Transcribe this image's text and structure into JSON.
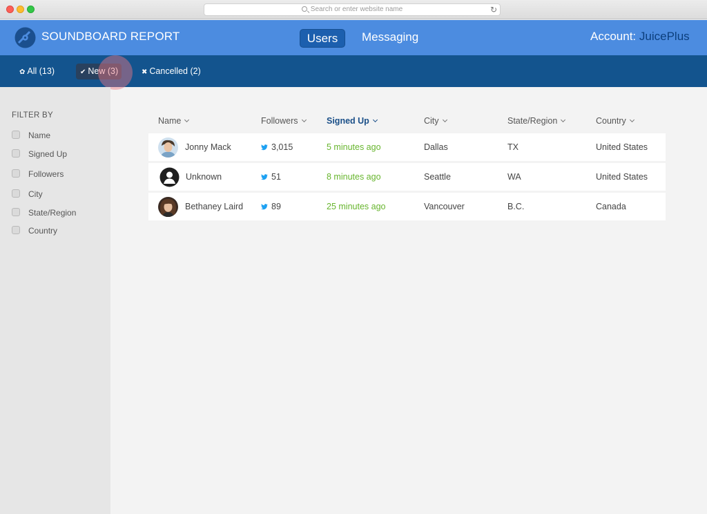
{
  "browser": {
    "url_placeholder": "Search or enter website name"
  },
  "header": {
    "brand": "SOUNDBOARD REPORT",
    "nav": [
      {
        "label": "Users",
        "active": true
      },
      {
        "label": "Messaging",
        "active": false
      }
    ],
    "account_label": "Account:",
    "account_name": "JuicePlus"
  },
  "tabs": [
    {
      "icon": "paw-icon",
      "label": "All (13)"
    },
    {
      "icon": "check-icon",
      "label": "New (3)",
      "active": true
    },
    {
      "icon": "x-icon",
      "label": "Cancelled (2)"
    }
  ],
  "sidebar": {
    "title": "FILTER BY",
    "filters": [
      "Name",
      "Signed Up",
      "Followers",
      "City",
      "State/Region",
      "Country"
    ]
  },
  "table": {
    "columns": [
      "Name",
      "Followers",
      "Signed Up",
      "City",
      "State/Region",
      "Country"
    ],
    "sorted_column": "Signed Up",
    "rows": [
      {
        "name": "Jonny Mack",
        "followers": "3,015",
        "signed_up": "5 minutes ago",
        "city": "Dallas",
        "state": "TX",
        "country": "United States"
      },
      {
        "name": "Unknown",
        "followers": "51",
        "signed_up": "8 minutes ago",
        "city": "Seattle",
        "state": "WA",
        "country": "United States"
      },
      {
        "name": "Bethaney Laird",
        "followers": "89",
        "signed_up": "25 minutes ago",
        "city": "Vancouver",
        "state": "B.C.",
        "country": "Canada"
      }
    ]
  },
  "colors": {
    "header_blue": "#4c8ce0",
    "tabbar_navy": "#13548e",
    "signed_green": "#67b52d",
    "twitter_blue": "#1da1f2"
  }
}
